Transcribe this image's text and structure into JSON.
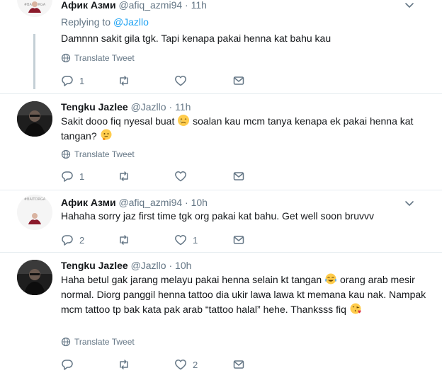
{
  "tweets": [
    {
      "name": "Афик Азми",
      "handle": "@afiq_azmi94",
      "dot": "·",
      "time": "11h",
      "replying_prefix": "Replying to",
      "replying_mention": "@Jazllo",
      "text": "Damnnn sakit gila tgk. Tapi kenapa pakai henna kat bahu kau",
      "translate": "Translate Tweet",
      "reply_count": "1",
      "retweet_count": "",
      "like_count": "",
      "avatar_caption": "#BAITORGA"
    },
    {
      "name": "Tengku Jazlee",
      "handle": "@Jazllo",
      "dot": "·",
      "time": "11h",
      "text_a": "Sakit dooo fiq nyesal buat",
      "text_b": "soalan kau mcm tanya kenapa ek pakai henna kat tangan?",
      "translate": "Translate Tweet",
      "reply_count": "1",
      "retweet_count": "",
      "like_count": ""
    },
    {
      "name": "Афик Азми",
      "handle": "@afiq_azmi94",
      "dot": "·",
      "time": "10h",
      "text": "Hahaha sorry jaz first time tgk org pakai kat bahu. Get well soon bruvvv",
      "reply_count": "2",
      "retweet_count": "",
      "like_count": "1",
      "avatar_caption": "#BAITORGA"
    },
    {
      "name": "Tengku Jazlee",
      "handle": "@Jazllo",
      "dot": "·",
      "time": "10h",
      "text_a": "Haha betul gak jarang melayu pakai henna selain kt tangan",
      "text_b": "orang arab mesir normal. Diorg panggil henna tattoo dia ukir lawa lawa kt memana kau nak. Nampak mcm tattoo tp bak kata pak arab “tattoo halal” hehe. Thanksss fiq",
      "translate": "Translate Tweet",
      "reply_count": "",
      "retweet_count": "",
      "like_count": "2"
    }
  ],
  "colors": {
    "link": "#1da1f2",
    "muted": "#657786",
    "text": "#14171a",
    "thread_line": "#c4cfd6",
    "divider": "#e6ecf0"
  },
  "icons": [
    "reply-icon",
    "retweet-icon",
    "like-icon",
    "direct-message-icon",
    "globe-icon",
    "chevron-down-icon",
    "crying-face-emoji",
    "thinking-face-emoji",
    "tears-of-joy-emoji",
    "face-blowing-kiss-emoji"
  ]
}
